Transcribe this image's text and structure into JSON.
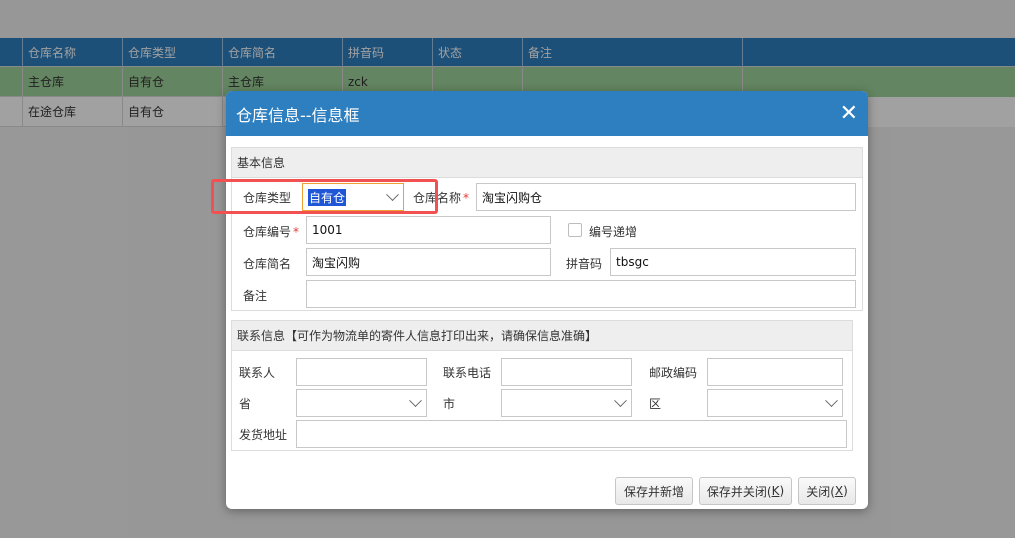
{
  "grid": {
    "columns": [
      "仓库名称",
      "仓库类型",
      "仓库简名",
      "拼音码",
      "状态",
      "备注"
    ],
    "rows": [
      {
        "name": "主仓库",
        "type": "自有仓",
        "short": "主仓库",
        "pinyin": "zck",
        "status": "",
        "note": ""
      },
      {
        "name": "在途仓库",
        "type": "自有仓",
        "short": "",
        "pinyin": "",
        "status": "",
        "note": ""
      }
    ]
  },
  "dialog": {
    "title": "仓库信息--信息框",
    "close_icon": "close-icon",
    "basic_section": "基本信息",
    "warehouse_type_label": "仓库类型",
    "warehouse_type_value": "自有仓",
    "warehouse_name_label": "仓库名称",
    "warehouse_name_value": "淘宝闪购仓",
    "warehouse_code_label": "仓库编号",
    "warehouse_code_value": "1001",
    "auto_increment_label": "编号递增",
    "warehouse_short_label": "仓库简名",
    "warehouse_short_value": "淘宝闪购",
    "pinyin_label": "拼音码",
    "pinyin_value": "tbsgc",
    "note_label": "备注",
    "note_value": "",
    "required_mark": "*",
    "contact_section": "联系信息【可作为物流单的寄件人信息打印出来，请确保信息准确】",
    "contact_person_label": "联系人",
    "contact_phone_label": "联系电话",
    "postal_code_label": "邮政编码",
    "province_label": "省",
    "city_label": "市",
    "district_label": "区",
    "ship_address_label": "发货地址",
    "buttons": {
      "save_new": "保存并新增",
      "save_close_text": "保存并关闭(",
      "save_close_key": "K",
      "close_text": "关闭(",
      "close_key": "X",
      "paren_close": ")"
    }
  },
  "colors": {
    "header_blue": "#2e7fc0",
    "selected_row": "#9ed39a",
    "highlight_red": "#f25151",
    "selection_blue": "#1e56d6"
  }
}
